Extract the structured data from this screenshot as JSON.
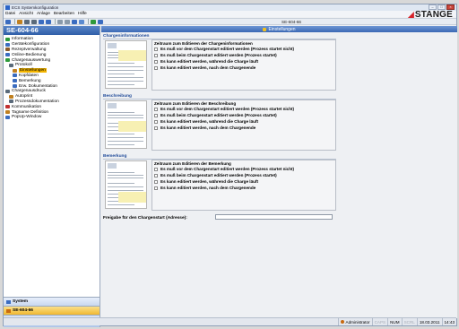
{
  "window": {
    "title": "ECS Systemkonfiguration"
  },
  "menu": [
    "Datei",
    "Ansicht",
    "Anlage",
    "Bearbeiten",
    "Hilfe"
  ],
  "brand": {
    "name": "STANGE",
    "color": "#d6232a"
  },
  "toolbar": {
    "instance_label": "SE-604-66"
  },
  "left": {
    "header": "SE-604-66",
    "tree": [
      {
        "label": "Information",
        "icon": "info-icon",
        "color": "#2e9a3a",
        "indent": 0
      },
      {
        "label": "Gerätekonfiguration",
        "icon": "device-icon",
        "color": "#3a6cc0",
        "indent": 0
      },
      {
        "label": "Rezeptverwaltung",
        "icon": "recipe-icon",
        "color": "#8a5a2a",
        "indent": 0
      },
      {
        "label": "Online-Bedienung",
        "icon": "online-icon",
        "color": "#3a6cc0",
        "indent": 0
      },
      {
        "label": "Chargenauswertung",
        "icon": "chart-icon",
        "color": "#2e9a3a",
        "indent": 0
      },
      {
        "label": "Protokoll",
        "icon": "log-icon",
        "color": "#5a6a7a",
        "indent": 1
      },
      {
        "label": "Einstellungen",
        "icon": "settings-icon",
        "color": "#c08020",
        "indent": 2,
        "selected": true
      },
      {
        "label": "Kopfdaten",
        "icon": "header-data-icon",
        "color": "#3a6cc0",
        "indent": 2
      },
      {
        "label": "Bemerkung",
        "icon": "note-icon",
        "color": "#3a6cc0",
        "indent": 2
      },
      {
        "label": "Erw. Dokumentation",
        "icon": "doc-icon",
        "color": "#3a6cc0",
        "indent": 2
      },
      {
        "label": "Chargenausdruck",
        "icon": "print-icon",
        "color": "#5a6a7a",
        "indent": 0
      },
      {
        "label": "Autoprint",
        "icon": "autoprint-icon",
        "color": "#c08020",
        "indent": 1
      },
      {
        "label": "Prozessdokumentation",
        "icon": "process-doc-icon",
        "color": "#5a6a7a",
        "indent": 1
      },
      {
        "label": "Kommunikation",
        "icon": "comm-icon",
        "color": "#c03030",
        "indent": 0
      },
      {
        "label": "Tagname Definition",
        "icon": "tag-icon",
        "color": "#c08020",
        "indent": 0
      },
      {
        "label": "PopUp-Window",
        "icon": "popup-icon",
        "color": "#3a6cc0",
        "indent": 0
      }
    ],
    "nav_groups": [
      {
        "label": "System",
        "style": "sys"
      },
      {
        "label": "SE-604-66",
        "style": "inst"
      }
    ]
  },
  "main": {
    "header": "Einstellungen",
    "sections": [
      {
        "title": "Chargeninformationen",
        "legend": "Zeitraum zum Editieren der Chargeninformationen",
        "options": [
          "Es muß vor dem Chargenstart editiert werden (Prozess startet nicht)",
          "Es muß beim Chargenstart editiert werden (Prozess startet)",
          "Es kann editiert werden, während die Charge läuft",
          "Es kann editiert werden, nach dem Chargenende"
        ]
      },
      {
        "title": "Beschreibung",
        "legend": "Zeitraum zum Editieren der Beschreibung",
        "options": [
          "Es muß vor dem Chargenstart editiert werden (Prozess startet nicht)",
          "Es muß beim Chargenstart editiert werden (Prozess startet)",
          "Es kann editiert werden, während die Charge läuft",
          "Es kann editiert werden, nach dem Chargenende"
        ]
      },
      {
        "title": "Bemerkung",
        "legend": "Zeitraum zum Editieren der Bemerkung",
        "options": [
          "Es muß vor dem Chargenstart editiert werden (Prozess startet nicht)",
          "Es muß beim Chargenstart editiert werden (Prozess startet)",
          "Es kann editiert werden, während die Charge läuft",
          "Es kann editiert werden, nach dem Chargenende"
        ]
      }
    ],
    "freigabe_label": "Freigabe für den Chargenstart (Adresse):",
    "freigabe_value": ""
  },
  "status": {
    "user": "Administrator",
    "caps": "CAPS",
    "num": "NUM",
    "scrl": "SCRL",
    "date": "18.03.2011",
    "time": "14:43"
  }
}
